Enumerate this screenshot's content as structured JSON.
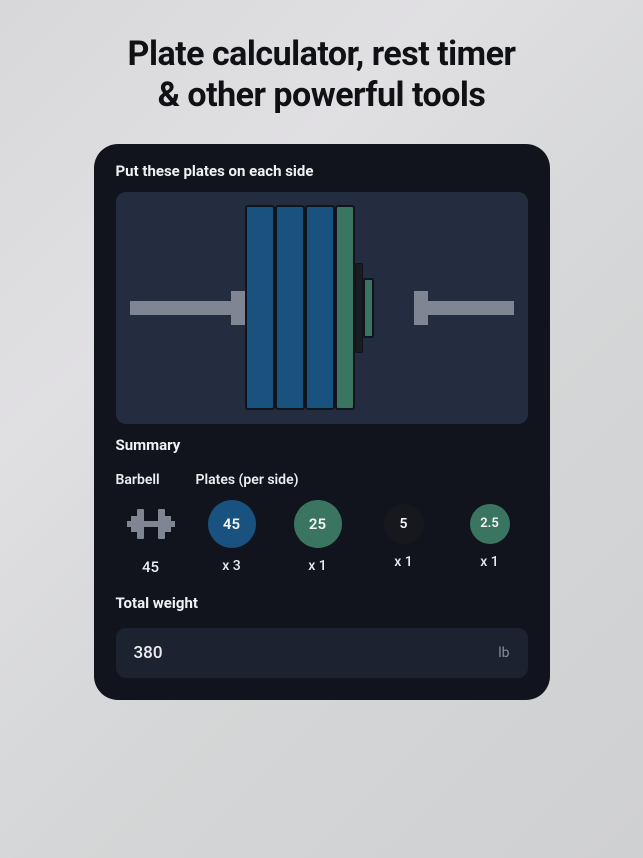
{
  "headline_line1": "Plate calculator, rest timer",
  "headline_line2": "& other powerful tools",
  "card": {
    "instruction": "Put these plates on each side",
    "summary_label": "Summary",
    "barbell_label": "Barbell",
    "plates_label": "Plates (per side)",
    "barbell_weight": "45",
    "plates": [
      {
        "weight": "45",
        "count": "x 3",
        "color": "c45"
      },
      {
        "weight": "25",
        "count": "x 1",
        "color": "c25"
      },
      {
        "weight": "5",
        "count": "x 1",
        "color": "c5"
      },
      {
        "weight": "2.5",
        "count": "x 1",
        "color": "c2_5"
      }
    ],
    "total_label": "Total weight",
    "total_value": "380",
    "total_unit": "lb"
  }
}
